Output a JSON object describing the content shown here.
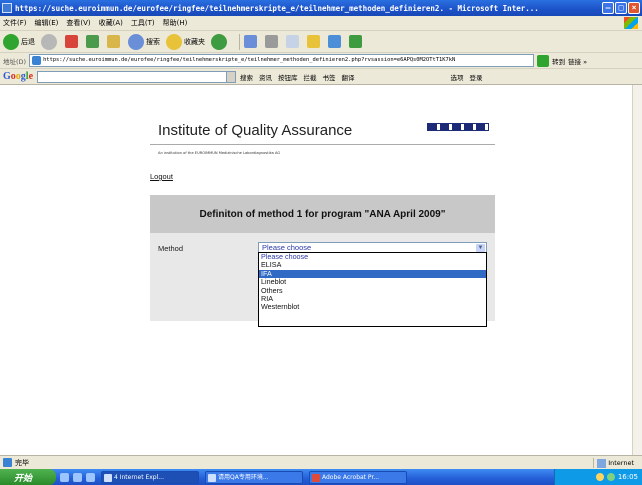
{
  "window": {
    "title": "https://suche.euroimmun.de/eurofee/ringfee/teilnehmerskripte_e/teilnehmer_methoden_definieren2. - Microsoft Inter..."
  },
  "menubar": {
    "items": [
      "文件(F)",
      "编辑(E)",
      "查看(V)",
      "收藏(A)",
      "工具(T)",
      "帮助(H)"
    ]
  },
  "toolbar": {
    "back": "后退",
    "search": "搜索",
    "favorites": "收藏夹"
  },
  "addressbar": {
    "label": "地址(D)",
    "url": "https://suche.euroimmun.de/eurofee/ringfee/teilnehmerskripte_e/teilnehmer_methoden_definieren2.php?rvsassion=e6APQs0M2OTtT1K7kN",
    "go": "转到",
    "links": "链接 »"
  },
  "googlebar": {
    "logo": [
      "G",
      "o",
      "o",
      "g",
      "l",
      "e"
    ],
    "items": [
      "搜索",
      "资讯",
      "按钮库",
      "拦截",
      "书签",
      "翻译",
      "选项",
      "登录"
    ]
  },
  "page": {
    "institute_title": "Institute of Quality Assurance",
    "institute_subtitle": "An institution of the EUROIMMUN Medizinische Labordiagnostika AG",
    "logout": "Logout",
    "panel_heading": "Definiton of method 1 for program \"ANA April 2009\"",
    "method_label": "Method",
    "select_value": "Please choose",
    "options": [
      "Please choose",
      "ELISA",
      "IFA",
      "Lineblot",
      "Others",
      "RIA",
      "Westernblot"
    ],
    "highlighted_option": "IFA"
  },
  "statusbar": {
    "text": "完毕",
    "zone": "Internet"
  },
  "taskbar": {
    "start": "开始",
    "tasks": [
      "4 Internet Expl...",
      "请用QA专用环境...",
      "Adobe Acrobat Pr..."
    ],
    "clock": "16:05"
  }
}
